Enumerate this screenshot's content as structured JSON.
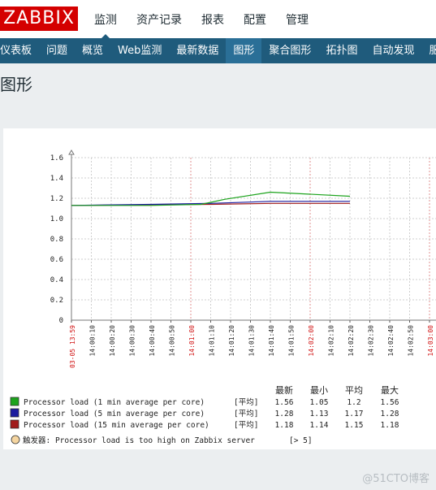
{
  "header": {
    "logo": "ZABBIX",
    "menu": [
      {
        "label": "监测",
        "active": true
      },
      {
        "label": "资产记录"
      },
      {
        "label": "报表"
      },
      {
        "label": "配置"
      },
      {
        "label": "管理"
      }
    ]
  },
  "subnav": {
    "items": [
      {
        "label": "仪表板"
      },
      {
        "label": "问题"
      },
      {
        "label": "概览"
      },
      {
        "label": "Web监测"
      },
      {
        "label": "最新数据"
      },
      {
        "label": "图形",
        "active": true
      },
      {
        "label": "聚合图形"
      },
      {
        "label": "拓扑图"
      },
      {
        "label": "自动发现"
      },
      {
        "label": "服务"
      }
    ]
  },
  "page": {
    "title": "图形"
  },
  "colors": {
    "accent_nav": "#1f5b7c",
    "brand_red": "#d40000",
    "series_green": "#1ca31c",
    "series_blue": "#1c1c9e",
    "series_red": "#a11c1c",
    "trigger": "#f5d5a0",
    "time_red": "#d01010"
  },
  "chart_data": {
    "type": "line",
    "ylim": [
      0,
      1.6
    ],
    "yticks": [
      "0",
      "0.2",
      "0.4",
      "0.6",
      "0.8",
      "1.0",
      "1.2",
      "1.4",
      "1.6"
    ],
    "xlabels": [
      {
        "text": "03-05 13:59",
        "red": true
      },
      {
        "text": "14:00:10"
      },
      {
        "text": "14:00:20"
      },
      {
        "text": "14:00:30"
      },
      {
        "text": "14:00:40"
      },
      {
        "text": "14:00:50"
      },
      {
        "text": "14:01:00",
        "red": true
      },
      {
        "text": "14:01:10"
      },
      {
        "text": "14:01:20"
      },
      {
        "text": "14:01:30"
      },
      {
        "text": "14:01:40"
      },
      {
        "text": "14:01:50"
      },
      {
        "text": "14:02:00",
        "red": true
      },
      {
        "text": "14:02:10"
      },
      {
        "text": "14:02:20"
      },
      {
        "text": "14:02:30"
      },
      {
        "text": "14:02:40"
      },
      {
        "text": "14:02:50"
      },
      {
        "text": "14:03:00",
        "red": true
      }
    ],
    "x_seconds": [
      0,
      140
    ],
    "series": [
      {
        "name": "Processor load (1 min average per core)",
        "color": "#1ca31c",
        "points": [
          [
            0,
            1.13
          ],
          [
            40,
            1.13
          ],
          [
            65,
            1.14
          ],
          [
            70,
            1.16
          ],
          [
            77,
            1.19
          ],
          [
            100,
            1.26
          ],
          [
            140,
            1.22
          ]
        ]
      },
      {
        "name": "Processor load (5 min average per core)",
        "color": "#1c1c9e",
        "points": [
          [
            0,
            1.13
          ],
          [
            40,
            1.14
          ],
          [
            70,
            1.15
          ],
          [
            100,
            1.17
          ],
          [
            140,
            1.17
          ]
        ]
      },
      {
        "name": "Processor load (15 min average per core)",
        "color": "#a11c1c",
        "points": [
          [
            0,
            1.13
          ],
          [
            70,
            1.14
          ],
          [
            100,
            1.15
          ],
          [
            140,
            1.15
          ]
        ]
      }
    ],
    "trigger": {
      "label": "触发器: Processor load is too high on Zabbix server",
      "value": "[> 5]"
    }
  },
  "legend": {
    "headers": [
      "最新",
      "最小",
      "平均",
      "最大"
    ],
    "rows": [
      {
        "name": "Processor load (1 min average per core)",
        "func": "[平均]",
        "last": "1.56",
        "min": "1.05",
        "avg": "1.2",
        "max": "1.56"
      },
      {
        "name": "Processor load (5 min average per core)",
        "func": "[平均]",
        "last": "1.28",
        "min": "1.13",
        "avg": "1.17",
        "max": "1.28"
      },
      {
        "name": "Processor load (15 min average per core)",
        "func": "[平均]",
        "last": "1.18",
        "min": "1.14",
        "avg": "1.15",
        "max": "1.18"
      }
    ]
  },
  "watermark": "@51CTO博客"
}
